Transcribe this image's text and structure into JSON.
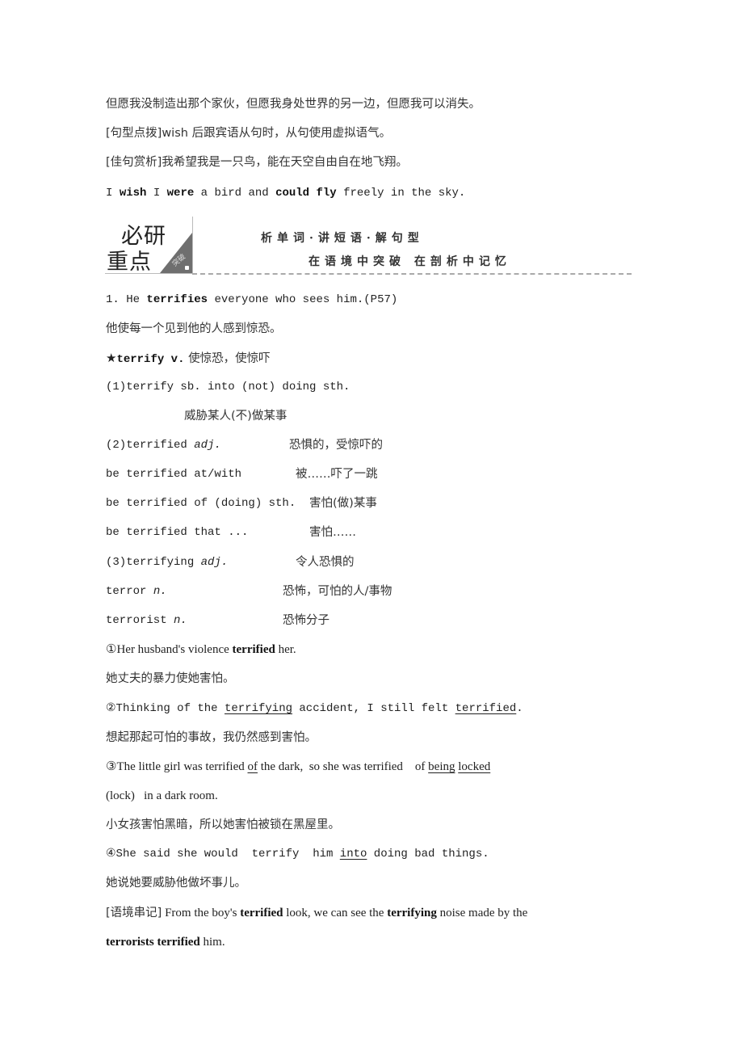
{
  "intro": {
    "line1": "但愿我没制造出那个家伙，但愿我身处世界的另一边，但愿我可以消失。",
    "tip_label": "[句型点拨]",
    "tip_text": "wish 后跟宾语从句时，从句使用虚拟语气。",
    "appreciate_label": "[佳句赏析]",
    "appreciate_text": "我希望我是一只鸟，能在天空自由自在地飞翔。",
    "example": {
      "p1": "I ",
      "b1": "wish",
      "p2": " I ",
      "b2": "were",
      "p3": " a bird and ",
      "b3": "could fly",
      "p4": " freely in the sky."
    }
  },
  "banner": {
    "badge_line1": "必研",
    "badge_line2": "重点",
    "badge_mini": "突破",
    "tagline1": "析单词·讲短语·解句型",
    "tagline2": "在语境中突破 在剖析中记忆"
  },
  "item1": {
    "sentence": {
      "p1": "1. He ",
      "b1": "terrifies",
      "p2": " everyone who sees him.(P57)"
    },
    "translation": "他使每一个见到他的人感到惊恐。",
    "headword": {
      "star": "★",
      "word": "terrify v.",
      "meaning": " 使惊恐，使惊吓"
    },
    "usages": [
      {
        "en": "(1)terrify sb. into (not) doing sth.",
        "zh": "威胁某人(不)做某事"
      },
      {
        "en_pre": "(2)terrified ",
        "en_pos": "adj.",
        "zh": "恐惧的，受惊吓的"
      },
      {
        "en": "be terrified at/with",
        "zh": "被……吓了一跳"
      },
      {
        "en": "be terrified of (doing) sth.",
        "zh": "害怕(做)某事"
      },
      {
        "en": "be terrified that ...",
        "zh": "害怕……"
      },
      {
        "en_pre": "(3)terrifying ",
        "en_pos": "adj.",
        "zh": "令人恐惧的"
      },
      {
        "en_pre": "terror ",
        "en_pos": "n.",
        "zh": "恐怖，可怕的人/事物"
      },
      {
        "en_pre": "terrorist ",
        "en_pos": "n.",
        "zh": "恐怖分子"
      }
    ],
    "examples": [
      {
        "p1": "①Her husband's violence ",
        "b1": "terrified",
        "p2": " her.",
        "zh": "她丈夫的暴力使她害怕。"
      },
      {
        "p1": "②Thinking of the ",
        "u1": "terrifying",
        "p2": " accident, I still felt ",
        "u2": "terrified",
        "p3": ".",
        "zh": "想起那起可怕的事故，我仍然感到害怕。"
      },
      {
        "p1": "③The little girl was terrified ",
        "u1": "of",
        "p2": " the dark,  so she was terrified    of ",
        "u2": "being",
        "p3": " ",
        "u3": "locked",
        "line2": "(lock)   in a dark room.",
        "zh": "小女孩害怕黑暗，所以她害怕被锁在黑屋里。"
      },
      {
        "p1": "④She said she would  terrify  him ",
        "u1": "into",
        "p2": " doing bad things.",
        "zh": "她说她要威胁他做坏事儿。"
      }
    ],
    "context": {
      "label": "[语境串记]",
      "p1": " From the boy's ",
      "b1": "terrified",
      "p2": " look, we can see the ",
      "b2": "terrifying",
      "p3": " noise made by the",
      "b3": "terrorists terrified",
      "p4": " him."
    }
  }
}
